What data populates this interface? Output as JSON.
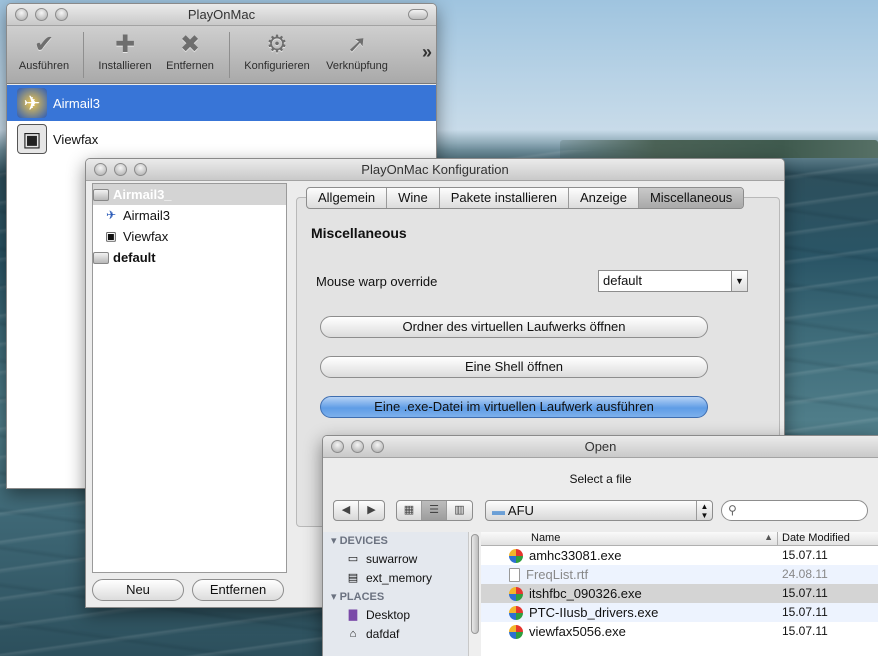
{
  "window_main": {
    "title": "PlayOnMac",
    "toolbar": [
      {
        "label": "Ausführen",
        "icon": "checkmark-icon",
        "glyph": "✔"
      },
      {
        "label": "Installieren",
        "icon": "plus-icon",
        "glyph": "✚"
      },
      {
        "label": "Entfernen",
        "icon": "x-icon",
        "glyph": "✖"
      },
      {
        "label": "Konfigurieren",
        "icon": "gear-icon",
        "glyph": "⚙"
      },
      {
        "label": "Verknüpfung",
        "icon": "arrow-icon",
        "glyph": "➚"
      }
    ],
    "overflow": "»",
    "apps": [
      {
        "name": "Airmail3",
        "icon": "airmail-icon",
        "glyph": "✈",
        "selected": true
      },
      {
        "name": "Viewfax",
        "icon": "viewfax-icon",
        "glyph": "▣",
        "selected": false
      }
    ]
  },
  "window_config": {
    "title": "PlayOnMac Konfiguration",
    "tree": {
      "root_selected": "Airmail3_",
      "children": [
        "Airmail3",
        "Viewfax"
      ],
      "root_default": "default"
    },
    "new_button": "Neu",
    "remove_button": "Entfernen",
    "tabs": [
      "Allgemein",
      "Wine",
      "Pakete installieren",
      "Anzeige",
      "Miscellaneous"
    ],
    "active_tab": "Miscellaneous",
    "section_title": "Miscellaneous",
    "mouse_warp_label": "Mouse warp override",
    "mouse_warp_value": "default",
    "buttons": {
      "open_drive": "Ordner des virtuellen Laufwerks öffnen",
      "open_shell": "Eine Shell öffnen",
      "run_exe": "Eine .exe-Datei im virtuellen Laufwerk ausführen"
    }
  },
  "window_open": {
    "title": "Open",
    "subtitle": "Select a file",
    "folder": "AFU",
    "search_placeholder": "",
    "sidebar": {
      "devices_header": "DEVICES",
      "devices": [
        "suwarrow",
        "ext_memory"
      ],
      "places_header": "PLACES",
      "places": [
        "Desktop",
        "dafdaf"
      ]
    },
    "columns": {
      "name": "Name",
      "date": "Date Modified"
    },
    "files": [
      {
        "name": "amhc33081.exe",
        "date": "15.07.11",
        "dim": false
      },
      {
        "name": "FreqList.rtf",
        "date": "24.08.11",
        "dim": true
      },
      {
        "name": "itshfbc_090326.exe",
        "date": "15.07.11",
        "dim": false
      },
      {
        "name": "PTC-IIusb_drivers.exe",
        "date": "15.07.11",
        "dim": false
      },
      {
        "name": "viewfax5056.exe",
        "date": "15.07.11",
        "dim": false
      }
    ],
    "selected_file_index": 2
  }
}
